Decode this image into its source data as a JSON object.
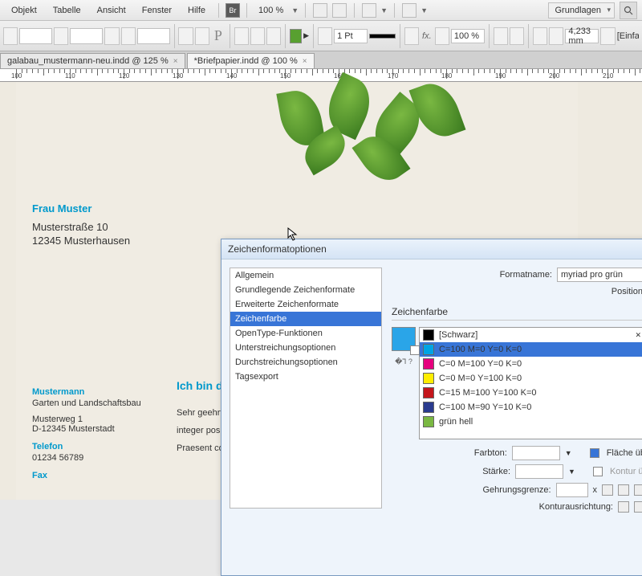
{
  "menu": {
    "items": [
      "Objekt",
      "Tabelle",
      "Ansicht",
      "Fenster",
      "Hilfe"
    ],
    "zoom": "100 %",
    "workspace": "Grundlagen"
  },
  "toolbar": {
    "stroke": "1 Pt",
    "opacity": "100 %",
    "measure": "4,233 mm",
    "einfach": "[Einfac"
  },
  "tabs": [
    {
      "label": "galabau_mustermann-neu.indd @ 125 %",
      "active": false
    },
    {
      "label": "*Briefpapier.indd @ 100 %",
      "active": true
    }
  ],
  "ruler": [
    100,
    110,
    120,
    130,
    140,
    150,
    160,
    170,
    180,
    190,
    200,
    210
  ],
  "doc": {
    "name": "Frau Muster",
    "street": "Musterstraße 10",
    "city": "12345 Musterhausen",
    "company": "Mustermann",
    "company2": "Garten und Landschaftsbau",
    "addr2": "Musterweg 1",
    "addr3": "D-12345 Musterstadt",
    "tel_h": "Telefon",
    "tel": "01234 56789",
    "fax_h": "Fax",
    "title": "Ich bin die H",
    "greet": "Sehr geehrte F",
    "p1": "integer posue",
    "p2": "Praesent com"
  },
  "dialog": {
    "title": "Zeichenformatoptionen",
    "formatname_label": "Formatname:",
    "formatname": "myriad pro grün",
    "position_label": "Position:",
    "section": "Zeichenfarbe",
    "side": [
      "Allgemein",
      "Grundlegende Zeichenformate",
      "Erweiterte Zeichenformate",
      "Zeichenfarbe",
      "OpenType-Funktionen",
      "Unterstreichungsoptionen",
      "Durchstreichungsoptionen",
      "Tagsexport"
    ],
    "side_sel": 3,
    "swatches": [
      {
        "name": "[Schwarz]",
        "c": "#000000",
        "reg": true
      },
      {
        "name": "C=100 M=0 Y=0 K=0",
        "c": "#00a4e4",
        "sel": true
      },
      {
        "name": "C=0 M=100 Y=0 K=0",
        "c": "#e6007e"
      },
      {
        "name": "C=0 M=0 Y=100 K=0",
        "c": "#ffed00"
      },
      {
        "name": "C=15 M=100 Y=100 K=0",
        "c": "#c4161c"
      },
      {
        "name": "C=100 M=90 Y=10 K=0",
        "c": "#2a3b8f"
      },
      {
        "name": "grün hell",
        "c": "#7ab842"
      }
    ],
    "labels": {
      "farbton": "Farbton:",
      "staerke": "Stärke:",
      "gehrung": "Gehrungsgrenze:",
      "kontur": "Konturausrichtung:",
      "flaeche": "Fläche üb",
      "konturchk": "Kontur ül",
      "x": "x"
    }
  }
}
